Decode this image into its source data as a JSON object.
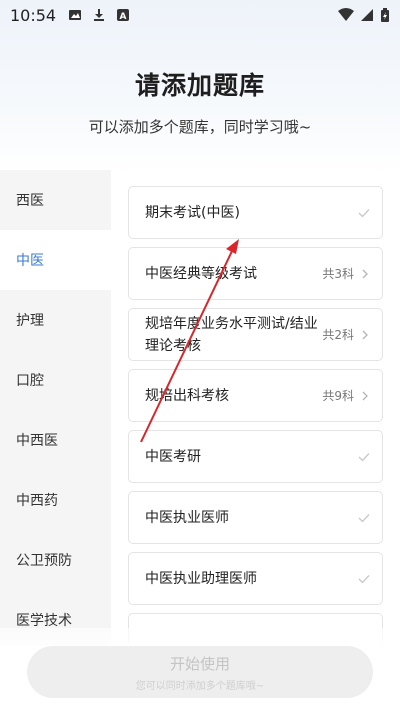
{
  "status_bar": {
    "time": "10:54"
  },
  "header": {
    "title": "请添加题库",
    "subtitle": "可以添加多个题库，同时学习哦~"
  },
  "sidebar": {
    "items": [
      {
        "label": "西医",
        "active": false
      },
      {
        "label": "中医",
        "active": true
      },
      {
        "label": "护理",
        "active": false
      },
      {
        "label": "口腔",
        "active": false
      },
      {
        "label": "中西医",
        "active": false
      },
      {
        "label": "中西药",
        "active": false
      },
      {
        "label": "公卫预防",
        "active": false
      },
      {
        "label": "医学技术",
        "active": false
      }
    ]
  },
  "banks": [
    {
      "title": "期末考试(中医)",
      "meta": "",
      "indicator": "check"
    },
    {
      "title": "中医经典等级考试",
      "meta": "共3科",
      "indicator": "chevron"
    },
    {
      "title": "规培年度业务水平测试/结业理论考核",
      "meta": "共2科",
      "indicator": "chevron"
    },
    {
      "title": "规培出科考核",
      "meta": "共9科",
      "indicator": "chevron"
    },
    {
      "title": "中医考研",
      "meta": "",
      "indicator": "check"
    },
    {
      "title": "中医执业医师",
      "meta": "",
      "indicator": "check"
    },
    {
      "title": "中医执业助理医师",
      "meta": "",
      "indicator": "check"
    }
  ],
  "footer": {
    "start_label": "开始使用",
    "start_hint": "您可以同时添加多个题库哦~"
  },
  "colors": {
    "accent": "#3a7bd5",
    "annotation_arrow": "#d9262a",
    "sidebar_bg": "#f5f5f5"
  }
}
